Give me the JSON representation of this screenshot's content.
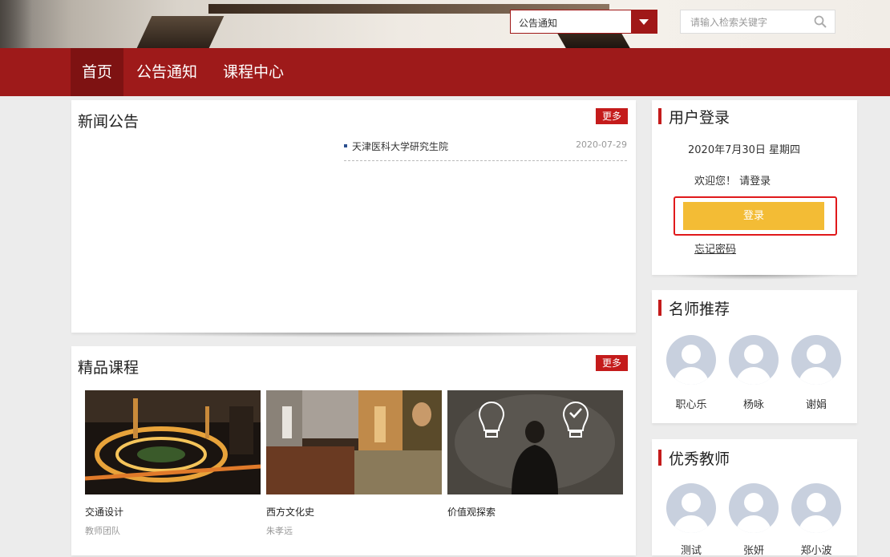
{
  "header": {
    "search_category": "公告通知",
    "search_placeholder": "请输入检索关键字"
  },
  "nav": {
    "items": [
      {
        "label": "首页",
        "active": true
      },
      {
        "label": "公告通知"
      },
      {
        "label": "课程中心"
      }
    ]
  },
  "news": {
    "title": "新闻公告",
    "more": "更多",
    "items": [
      {
        "title": "天津医科大学研究生院",
        "date": "2020-07-29"
      }
    ]
  },
  "courses": {
    "title": "精品课程",
    "more": "更多",
    "items": [
      {
        "name": "交通设计",
        "teacher": "教师团队"
      },
      {
        "name": "西方文化史",
        "teacher": "朱孝远"
      },
      {
        "name": "价值观探索",
        "teacher": ""
      }
    ]
  },
  "login": {
    "title": "用户登录",
    "date": "2020年7月30日 星期四",
    "welcome": "欢迎您！ 请登录",
    "login_button": "登录",
    "forgot": "忘记密码"
  },
  "famous_teachers": {
    "title": "名师推荐",
    "items": [
      {
        "name": "职心乐"
      },
      {
        "name": "杨咏"
      },
      {
        "name": "谢娟"
      }
    ]
  },
  "excellent_teachers": {
    "title": "优秀教师",
    "items": [
      {
        "name": "测试"
      },
      {
        "name": "张妍"
      },
      {
        "name": "郑小波"
      }
    ]
  },
  "colors": {
    "nav_bg": "#9e1a1a",
    "more_button": "#c41b1b",
    "login_button": "#f3bc35",
    "highlight_border": "#e0191b"
  }
}
